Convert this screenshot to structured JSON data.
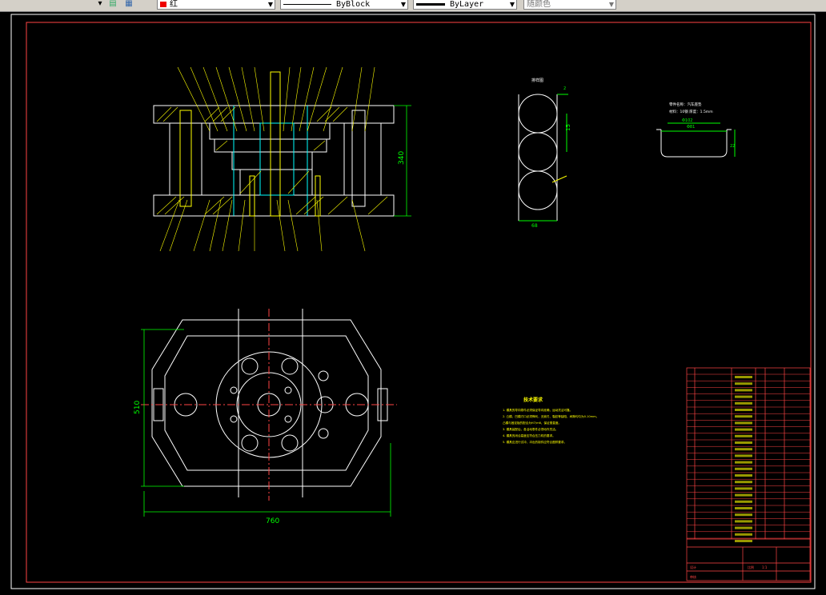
{
  "toolbar": {
    "color_value": "红",
    "linetype_value": "ByBlock",
    "lineweight_value": "ByLayer",
    "plotstyle_value": "随颜色"
  },
  "drawing": {
    "dim_width_front": "340",
    "dim_plan_width": "760",
    "dim_plan_height": "510",
    "strip_title": "排样图",
    "strip_dim_pitch": "15",
    "strip_dim_width": "68",
    "strip_dim_side": "2",
    "part_title": "零件名称：汽车座垫",
    "part_sub": "材料：10钢   厚度：1.5mm",
    "part_dim_dia": "Φ102",
    "part_dim_inner": "Φ81",
    "part_dim_h": "22",
    "tech_title": "技术要求",
    "tech_lines": [
      "1. 模具的导向零件必须保证导向准确，运动灵活可靠。",
      "2. 凸模、凹模刃口必须锋利，无崩刃、裂纹等缺陷，间隙均匀为0.10mm。",
      "   凸模与固定板的配合为H7/m6，保证垂直度。",
      "3. 模具装配后，各活动零件必须动作灵活。",
      "4. 模具的闭合高度应符合压力机的要求。",
      "5. 模具应进行试冲，冲出的制件应符合图样要求。"
    ]
  },
  "titleblock": {
    "designer": "设计",
    "checker": "审核",
    "scale_label": "比例",
    "scale": "1:1"
  }
}
